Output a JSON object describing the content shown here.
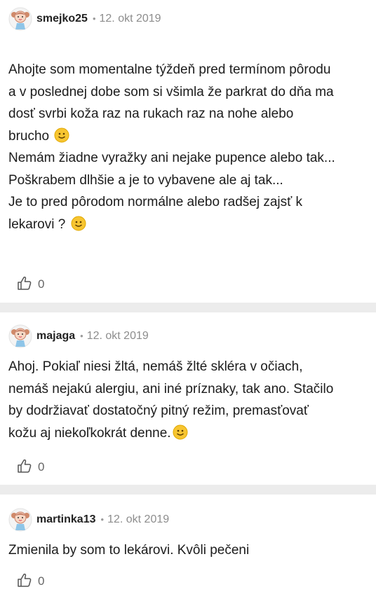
{
  "posts": [
    {
      "username": "smejko25",
      "date": "12. okt 2019",
      "lines": [
        "Ahojte som momentalne týždeň pred termínom pôrodu",
        "a v poslednej dobe som si všimla že parkrat do dňa ma",
        "dosť svrbi koža raz na rukach raz na nohe alebo",
        "brucho",
        "Nemám žiadne vyražky ani nejake pupence alebo tak...",
        "Poškrabem dlhšie a je to vybavene ale aj tak...",
        "Je to pred pôrodom normálne alebo radšej zajsť k",
        "lekarovi ?"
      ],
      "likes": "0"
    },
    {
      "username": "majaga",
      "date": "12. okt 2019",
      "lines": [
        "Ahoj. Pokiaľ niesi žltá, nemáš žlté skléra v očiach,",
        "nemáš nejakú alergiu, ani iné príznaky, tak ano. Stačilo",
        "by dodržiavať dostatočný pitný režim, premasťovať",
        "kožu aj niekoľkokrát denne."
      ],
      "likes": "0"
    },
    {
      "username": "martinka13",
      "date": "12. okt 2019",
      "lines": [
        "Zmienila by som to lekárovi. Kvôli pečeni"
      ],
      "likes": "0"
    }
  ],
  "separator": "•",
  "icons": {
    "avatar": "girl-avatar-icon",
    "like": "thumbs-up-icon",
    "emoji": "smiley-emoji-icon"
  },
  "colors": {
    "separator_bg": "#ececec",
    "emoji": "#f7c531"
  }
}
